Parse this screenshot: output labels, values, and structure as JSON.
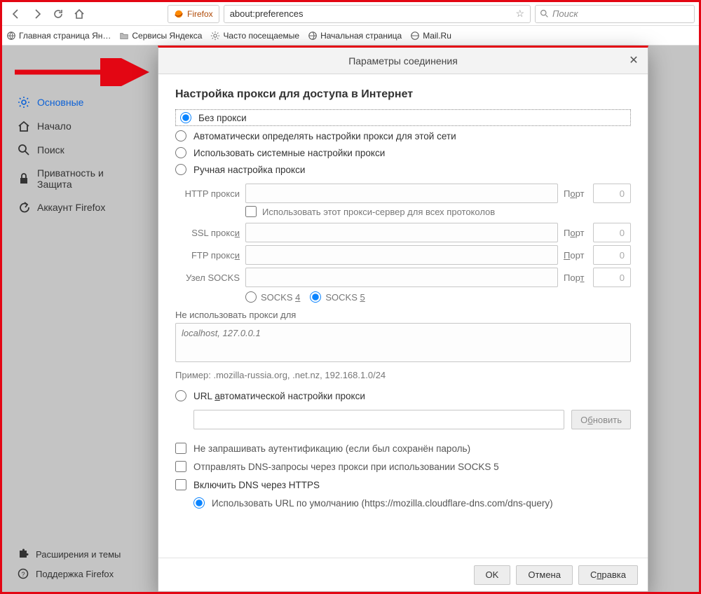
{
  "toolbar": {
    "identity_brand": "Firefox",
    "url": "about:preferences",
    "search_placeholder": "Поиск"
  },
  "bookmarks": [
    "Главная страница Ян…",
    "Сервисы Яндекса",
    "Часто посещаемые",
    "Начальная страница",
    "Mail.Ru"
  ],
  "sidebar": {
    "items": [
      {
        "label": "Основные"
      },
      {
        "label": "Начало"
      },
      {
        "label": "Поиск"
      },
      {
        "label": "Приватность и Защита"
      },
      {
        "label": "Аккаунт Firefox"
      }
    ],
    "extensions": "Расширения и темы",
    "support": "Поддержка Firefox"
  },
  "dialog": {
    "title": "Параметры соединения",
    "heading": "Настройка прокси для доступа в Интернет",
    "opt_none": "Без прокси",
    "opt_auto_detect": "Автоматически определять настройки прокси для этой сети",
    "opt_system": "Использовать системные настройки прокси",
    "opt_manual": "Ручная настройка прокси",
    "http_label": "HTTP прокси",
    "port_label": "Порт",
    "port_value": "0",
    "same_all": "Использовать этот прокси-сервер для всех протоколов",
    "ssl_label": "SSL прокси",
    "ftp_label": "FTP прокси",
    "socks_label": "Узел SOCKS",
    "socks4": "SOCKS 4",
    "socks5": "SOCKS 5",
    "noproxy_label": "Не использовать прокси для",
    "noproxy_placeholder": "localhost, 127.0.0.1",
    "example": "Пример: .mozilla-russia.org, .net.nz, 192.168.1.0/24",
    "opt_pac": "URL автоматической настройки прокси",
    "refresh_btn": "Обновить",
    "chk_noauth": "Не запрашивать аутентификацию (если был сохранён пароль)",
    "chk_dns_socks": "Отправлять DNS-запросы через прокси при использовании SOCKS 5",
    "chk_doh": "Включить DNS через HTTPS",
    "doh_default": "Использовать URL по умолчанию (https://mozilla.cloudflare-dns.com/dns-query)",
    "ok": "OK",
    "cancel": "Отмена",
    "help": "Справка"
  }
}
